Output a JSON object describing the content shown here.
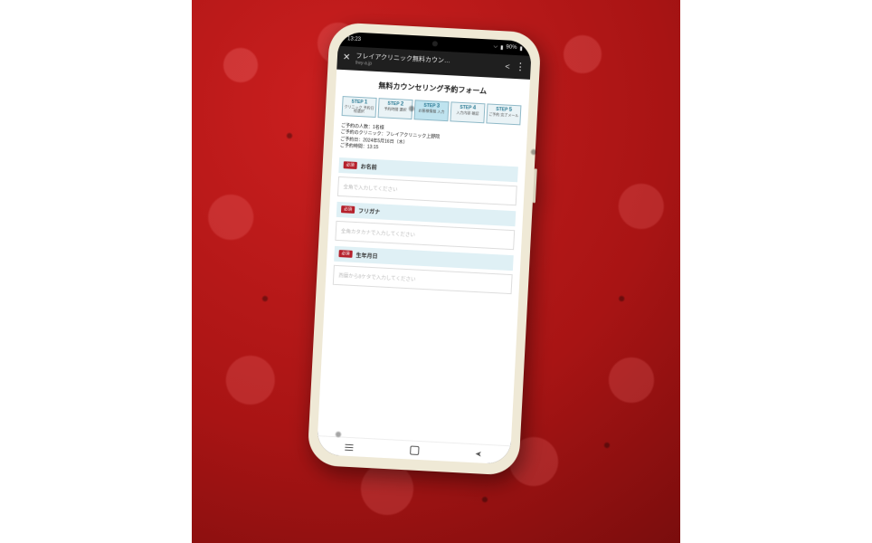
{
  "statusbar": {
    "time": "13:23",
    "battery": "90%"
  },
  "browser": {
    "title": "フレイアクリニック無料カウン…",
    "url": "frey-a.jp"
  },
  "page": {
    "title": "無料カウンセリング予約フォーム",
    "steps": [
      {
        "num": "1",
        "sub": "クリニック\n予約日程選択"
      },
      {
        "num": "2",
        "sub": "予約時間\n選択"
      },
      {
        "num": "3",
        "sub": "お客様情報\n入力"
      },
      {
        "num": "4",
        "sub": "入力内容\n確認"
      },
      {
        "num": "5",
        "sub": "ご予約\n完了メール"
      }
    ],
    "active_step": 2,
    "summary": {
      "l1": "ご予約の人数：1名様",
      "l2": "ご予約のクリニック：フレイアクリニック上野院",
      "l3": "ご予約日：2024年5月16日（木）",
      "l4": "ご予約時間：13:15"
    },
    "fields": [
      {
        "req": "必須",
        "label": "お名前",
        "placeholder": "全角で入力してください"
      },
      {
        "req": "必須",
        "label": "フリガナ",
        "placeholder": "全角カタカナで入力してください"
      },
      {
        "req": "必須",
        "label": "生年月日",
        "placeholder": "西暦から8ケタで入力してください"
      }
    ]
  }
}
